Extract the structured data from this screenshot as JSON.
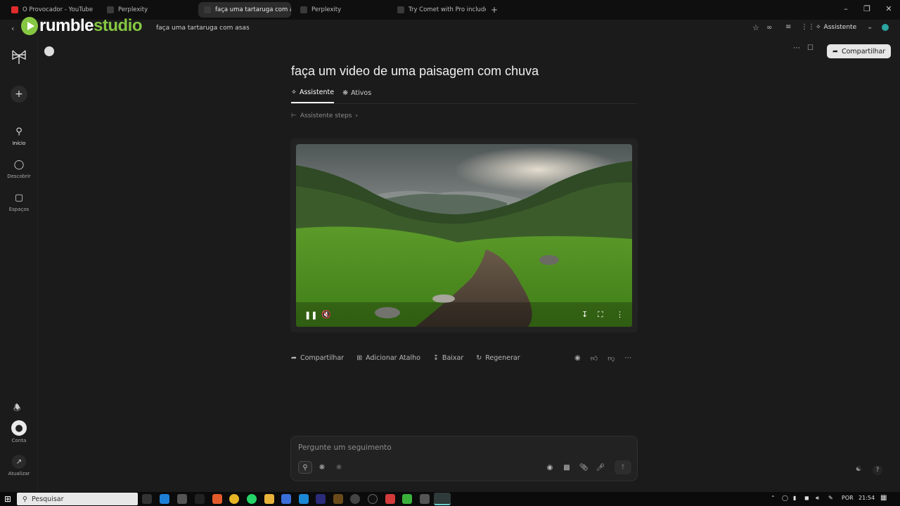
{
  "browser": {
    "tabs": [
      {
        "label": "O Provocador - YouTube",
        "fav": "#e02b2b",
        "active": false
      },
      {
        "label": "Perplexity",
        "fav": "#3a3a3a",
        "active": false
      },
      {
        "label": "faça uma tartaruga com asas",
        "fav": "#3a3a3a",
        "active": true
      },
      {
        "label": "Perplexity",
        "fav": "#3a3a3a",
        "active": false
      },
      {
        "label": "Try Comet with Pro included",
        "fav": "#3a3a3a",
        "active": false
      }
    ],
    "new_tab": "+",
    "url_text": "faça uma tartaruga com asas",
    "assistant_label": "Assistente"
  },
  "overlay": {
    "brand_a": "rumble",
    "brand_b": "studio"
  },
  "sidebar": {
    "new": "+",
    "items": [
      {
        "label": "Início",
        "icon": "search-icon"
      },
      {
        "label": "Descobrir",
        "icon": "compass-icon"
      },
      {
        "label": "Espaços",
        "icon": "spaces-icon"
      }
    ],
    "account": "Conta",
    "upgrade": "Atualizar"
  },
  "thread": {
    "title": "faça um video de uma paisagem com chuva",
    "tabs": [
      "Assistente",
      "Ativos"
    ],
    "steps": "Assistente steps",
    "share": "Compartilhar",
    "actions": [
      "Compartilhar",
      "Adicionar Atalho",
      "Baixar",
      "Regenerar"
    ],
    "composer_placeholder": "Pergunte um seguimento"
  },
  "taskbar": {
    "search": "Pesquisar",
    "lang": "POR",
    "time": "21:54"
  }
}
